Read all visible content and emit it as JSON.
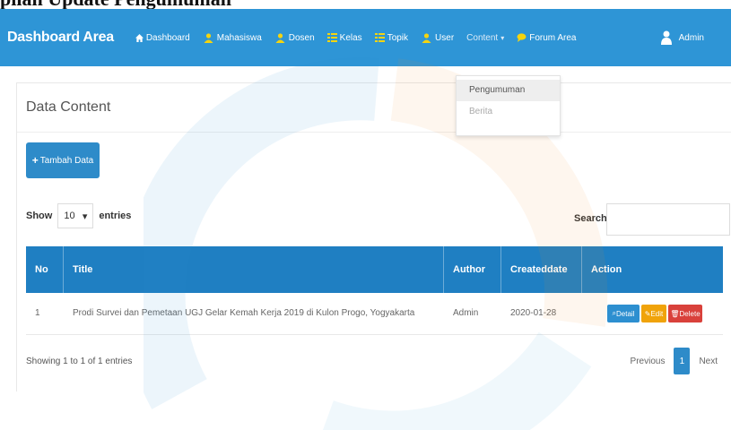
{
  "caption": "pilan Update Pengumuman",
  "navbar": {
    "brand": "Dashboard Area",
    "items": [
      {
        "label": "Dashboard",
        "icon": "home-icon"
      },
      {
        "label": "Mahasiswa",
        "icon": "users-icon"
      },
      {
        "label": "Dosen",
        "icon": "users-icon"
      },
      {
        "label": "Kelas",
        "icon": "list-icon"
      },
      {
        "label": "Topik",
        "icon": "list-icon"
      },
      {
        "label": "User",
        "icon": "users-icon"
      },
      {
        "label": "Content",
        "icon": "caret-down-icon"
      },
      {
        "label": "Forum Area",
        "icon": "comments-icon"
      }
    ],
    "user": "Admin"
  },
  "dropdown": [
    "Pengumuman",
    "Berita"
  ],
  "panel": {
    "title": "Data Content",
    "add_button": "Tambah Data",
    "length": {
      "show": "Show",
      "value": "10",
      "entries": "entries"
    },
    "search_label": "Search:",
    "columns": [
      "No",
      "Title",
      "Author",
      "Createddate",
      "Action"
    ],
    "rows": [
      {
        "no": "1",
        "title": "Prodi Survei dan Pemetaan UGJ Gelar Kemah Kerja 2019 di Kulon Progo, Yogyakarta",
        "author": "Admin",
        "date": "2020-01-28"
      }
    ],
    "actions": {
      "detail": "Detail",
      "edit": "Edit",
      "delete": "Delete"
    },
    "info": "Showing 1 to 1 of 1 entries",
    "pagination": {
      "previous": "Previous",
      "current": "1",
      "next": "Next"
    }
  },
  "colors": {
    "navbar": "#2e95d6",
    "table_header": "#1f7fc2",
    "detail": "#2d8fd0",
    "edit": "#f0a30a",
    "delete": "#d9413b"
  }
}
